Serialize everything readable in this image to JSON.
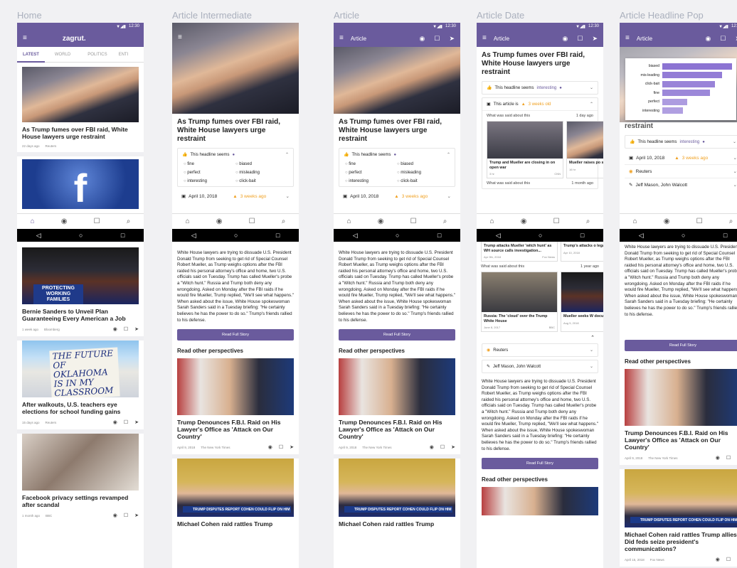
{
  "screens": {
    "home": {
      "label": "Home",
      "app_title": "zagrut.",
      "tabs": [
        "LATEST",
        "WORLD",
        "POLITICS",
        "ENTI"
      ],
      "cards": [
        {
          "title": "As Trump fumes over FBI raid, White House lawyers urge restraint",
          "age": "22 days ago",
          "source": "Reuters"
        },
        {
          "title": "",
          "age": "",
          "source": ""
        },
        {
          "title": "Bernie Sanders to Unveil Plan Guaranteeing Every American a Job",
          "age": "1 week ago",
          "source": "Bloomberg",
          "sign": "PROTECTING WORKING FAMILIES"
        },
        {
          "title": "After walkouts, U.S. teachers eye elections for school funding gains",
          "age": "15 days ago",
          "source": "Reuters",
          "sign": "THE FUTURE OF OKLAHOMA IS IN MY CLASSROOM"
        },
        {
          "title": "Facebook privacy settings revamped after scandal",
          "age": "1 month ago",
          "source": "BBC"
        }
      ],
      "fb_letter": "f"
    },
    "intermediate": {
      "label": "Article Intermediate",
      "headline": "As Trump fumes over FBI raid, White House lawyers urge restraint",
      "seems": "This headline seems",
      "options": [
        "fine",
        "biased",
        "perfect",
        "misleading",
        "interesting",
        "click-bait"
      ],
      "date": "April 10, 2018",
      "warn": "3 weeks ago"
    },
    "article": {
      "label": "Article",
      "bar_title": "Article",
      "headline": "As Trump fumes over FBI raid, White House lawyers urge restraint",
      "seems": "This headline seems",
      "options": [
        "fine",
        "biased",
        "perfect",
        "misleading",
        "interesting",
        "click-bait"
      ],
      "date": "April 10, 2018",
      "warn": "3 weeks ago"
    },
    "date": {
      "label": "Article Date",
      "bar_title": "Article",
      "headline": "As Trump fumes over FBI raid, White House lawyers urge restraint",
      "seems": "This headline seems",
      "seems_value": "interesting",
      "article_is": "This article is",
      "warn": "3 weeks old",
      "said1": {
        "label": "What was said about this",
        "ago": "1 day ago"
      },
      "said1_cards": [
        {
          "title": "Trump and Mueller are closing in on open war",
          "age": "3 hr",
          "source": "CNN"
        },
        {
          "title": "Mueller raises po subpoena: forme",
          "age": "16 hr",
          "source": ""
        }
      ],
      "said2": {
        "label": "What was said about this",
        "ago": "1 month ago"
      },
      "said2_cards": [
        {
          "title": "Trump attacks Mueller 'witch hunt' as WH source calls investigation...",
          "age": "Apr 9th, 2018",
          "source": "Fox News"
        },
        {
          "title": "Trump's attacks o legal threat after",
          "age": "Apr 10, 2018",
          "source": ""
        }
      ],
      "said3": {
        "label": "What was said about this",
        "ago": "1 year ago"
      },
      "said3_cards": [
        {
          "title": "Russia: The 'cloud' over the Trump White House",
          "age": "June 8, 2017",
          "source": "BBC"
        },
        {
          "title": "Mueller seeks W documents on F",
          "age": "Aug 5, 2018",
          "source": ""
        }
      ],
      "source": "Reuters",
      "authors": "Jeff Mason, John Walcott"
    },
    "pop": {
      "label": "Article Headline Pop",
      "bar_title": "Article",
      "chart_data": {
        "type": "bar",
        "categories": [
          "biased",
          "mis-leading",
          "click-bait",
          "fine",
          "perfect",
          "interesting"
        ],
        "values": [
          100,
          86,
          76,
          68,
          36,
          30
        ]
      },
      "behind_text": "restraint",
      "seems": "This headline seems",
      "seems_value": "interesting",
      "date": "April 10, 2018",
      "warn": "3 weeks ago",
      "source": "Reuters",
      "authors": "Jeff Mason, John Walcott"
    }
  },
  "body": "White House lawyers are trying to dissuade U.S. President Donald Trump from seeking to get rid of Special Counsel Robert Mueller, as Trump weighs options after the FBI raided his personal attorney's office and home, two U.S. officials said on Tuesday. Trump has called Mueller's probe a \"Witch hunt.\" Russia and Trump both deny any wrongdoing. Asked on Monday after the FBI raids if he would fire Mueller, Trump replied, \"We'll see what happens.\" When asked about the issue, White House spokeswoman Sarah Sanders said in a Tuesday briefing: \"He certainly believes he has the power to do so.\" Trump's friends rallied to his defense.",
  "read_full": "Read Full Story",
  "other_perspectives": "Read other perspectives",
  "perspectives": [
    {
      "title": "Trump Denounces F.B.I. Raid on His Lawyer's Office as 'Attack on Our Country'",
      "date": "April 9, 2018",
      "source": "The New York Times"
    },
    {
      "title": "Michael Cohen raid rattles Trump allies: Did feds seize president's communications?",
      "date": "April 15, 2018",
      "source": "Fox News",
      "ticker": "TRUMP DISPUTES REPORT COHEN COULD FLIP ON HIM"
    }
  ],
  "partial_title": "Michael Cohen raid rattles Trump",
  "time": "12:30",
  "colors": {
    "accent": "#6a5b9d",
    "warn": "#f0a020",
    "bar": "#8c74d3"
  },
  "icons": [
    "menu-icon",
    "eye-icon",
    "bookmark-icon",
    "share-icon",
    "home-icon",
    "search-icon",
    "back-icon",
    "circle-home-icon",
    "recents-icon"
  ]
}
